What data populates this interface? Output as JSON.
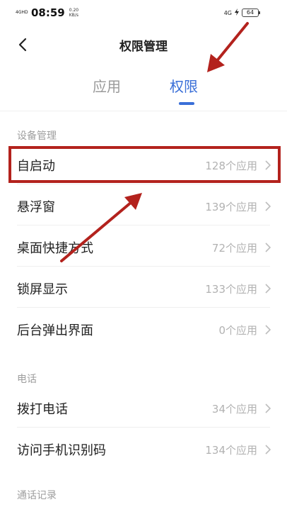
{
  "status_bar": {
    "network_type": "4GHD",
    "time": "08:59",
    "speed_value": "0.20",
    "speed_unit": "KB/s",
    "signal": "4G",
    "battery": "64"
  },
  "header": {
    "title": "权限管理"
  },
  "tabs": [
    {
      "label": "应用",
      "active": false
    },
    {
      "label": "权限",
      "active": true
    }
  ],
  "sections": [
    {
      "title": "设备管理",
      "items": [
        {
          "label": "自启动",
          "count": "128个应用"
        },
        {
          "label": "悬浮窗",
          "count": "139个应用"
        },
        {
          "label": "桌面快捷方式",
          "count": "72个应用"
        },
        {
          "label": "锁屏显示",
          "count": "133个应用"
        },
        {
          "label": "后台弹出界面",
          "count": "0个应用"
        }
      ]
    },
    {
      "title": "电话",
      "items": [
        {
          "label": "拨打电话",
          "count": "34个应用"
        },
        {
          "label": "访问手机识别码",
          "count": "134个应用"
        }
      ]
    },
    {
      "title": "通话记录",
      "items": []
    }
  ],
  "colors": {
    "accent": "#3a6fd8",
    "annotation": "#b3221d"
  }
}
